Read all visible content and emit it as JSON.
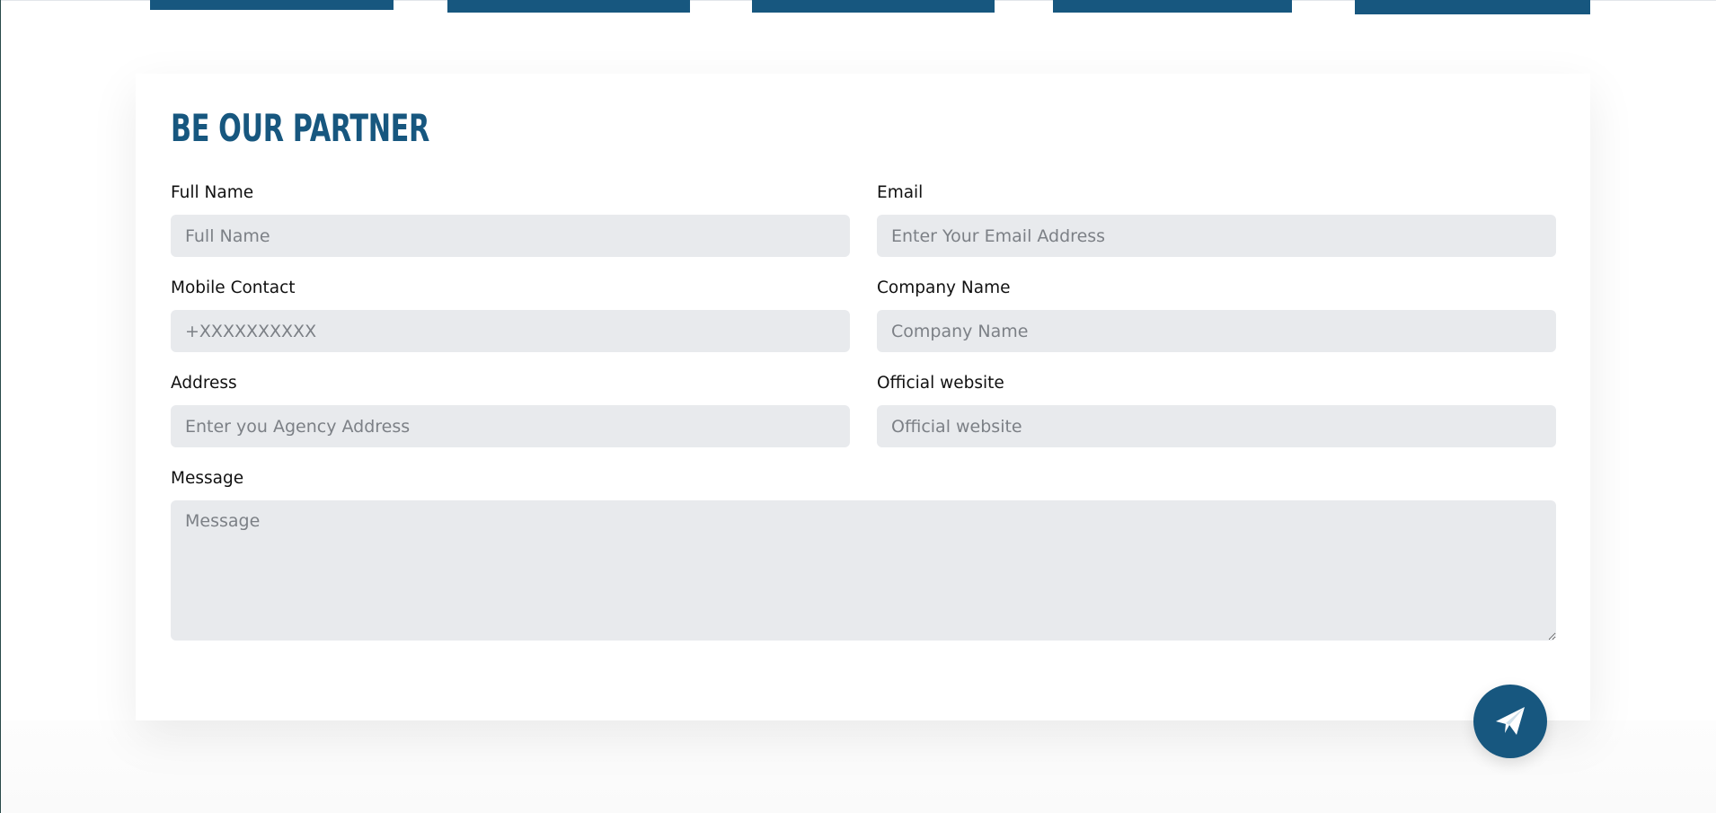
{
  "form": {
    "title": "BE OUR PARTNER",
    "fields": {
      "full_name": {
        "label": "Full Name",
        "placeholder": "Full Name",
        "value": ""
      },
      "email": {
        "label": "Email",
        "placeholder": "Enter Your Email Address",
        "value": ""
      },
      "mobile": {
        "label": "Mobile Contact",
        "placeholder": "+XXXXXXXXXX",
        "value": ""
      },
      "company": {
        "label": "Company Name",
        "placeholder": "Company Name",
        "value": ""
      },
      "address": {
        "label": "Address",
        "placeholder": "Enter you Agency Address",
        "value": ""
      },
      "website": {
        "label": "Official website",
        "placeholder": "Official website",
        "value": ""
      },
      "message": {
        "label": "Message",
        "placeholder": "Message",
        "value": ""
      }
    },
    "submit": {
      "icon": "paper-plane-icon"
    }
  },
  "colors": {
    "accent": "#17577f",
    "input_bg": "#e8eaed",
    "label": "#111111",
    "placeholder": "#7c8086"
  }
}
